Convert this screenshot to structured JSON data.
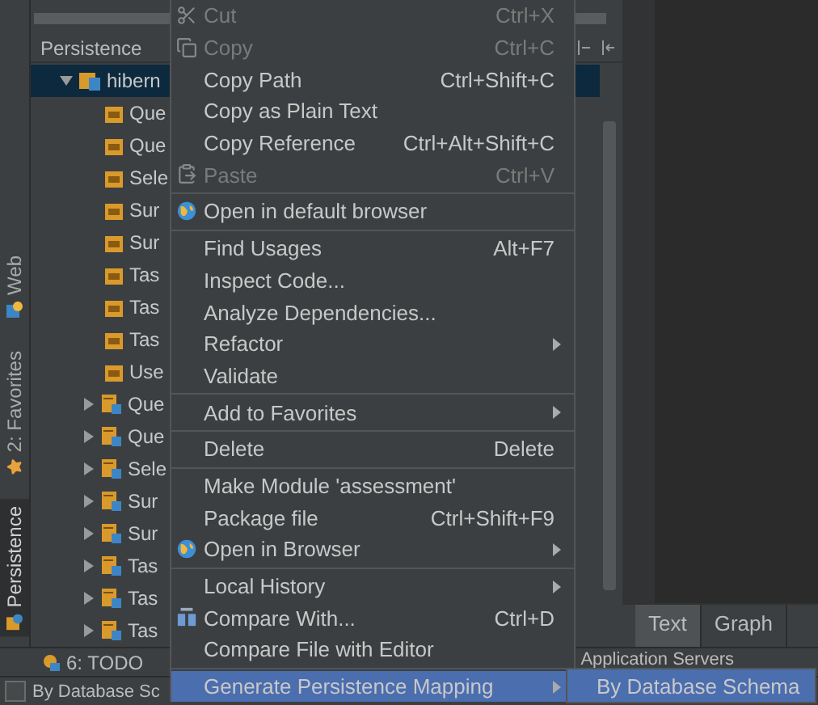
{
  "tool_strip": [
    {
      "label": "Web",
      "selected": false
    },
    {
      "label": "2: Favorites",
      "selected": false
    },
    {
      "label": "Persistence",
      "selected": true
    }
  ],
  "panel": {
    "title": "Persistence"
  },
  "tree": [
    {
      "label": "hibern",
      "selected": true,
      "expanded": true,
      "children": [
        {
          "label": "Que",
          "kind": "file"
        },
        {
          "label": "Que",
          "kind": "file"
        },
        {
          "label": "Sele",
          "kind": "file"
        },
        {
          "label": "Sur",
          "kind": "file"
        },
        {
          "label": "Sur",
          "kind": "file"
        },
        {
          "label": "Tas",
          "kind": "file"
        },
        {
          "label": "Tas",
          "kind": "file"
        },
        {
          "label": "Tas",
          "kind": "file"
        },
        {
          "label": "Use",
          "kind": "file"
        },
        {
          "label": "Que",
          "kind": "entity",
          "expanded": false
        },
        {
          "label": "Que",
          "kind": "entity",
          "expanded": false
        },
        {
          "label": "Sele",
          "kind": "entity",
          "expanded": false
        },
        {
          "label": "Sur",
          "kind": "entity",
          "expanded": false
        },
        {
          "label": "Sur",
          "kind": "entity",
          "expanded": false
        },
        {
          "label": "Tas",
          "kind": "entity",
          "expanded": false
        },
        {
          "label": "Tas",
          "kind": "entity",
          "expanded": false
        },
        {
          "label": "Tas",
          "kind": "entity",
          "expanded": false
        }
      ]
    }
  ],
  "context_menu": [
    {
      "kind": "item",
      "label": "Cut",
      "shortcut": "Ctrl+X",
      "disabled": true,
      "selected": false
    },
    {
      "kind": "item",
      "label": "Copy",
      "shortcut": "Ctrl+C",
      "disabled": true,
      "selected": false
    },
    {
      "kind": "item",
      "label": "Copy Path",
      "shortcut": "Ctrl+Shift+C",
      "disabled": false,
      "selected": false
    },
    {
      "kind": "item",
      "label": "Copy as Plain Text",
      "disabled": false,
      "selected": false
    },
    {
      "kind": "item",
      "label": "Copy Reference",
      "shortcut": "Ctrl+Alt+Shift+C",
      "disabled": false,
      "selected": false
    },
    {
      "kind": "item",
      "label": "Paste",
      "shortcut": "Ctrl+V",
      "disabled": true,
      "selected": false
    },
    {
      "kind": "separator"
    },
    {
      "kind": "item",
      "label": "Open in default browser",
      "disabled": false,
      "selected": false
    },
    {
      "kind": "separator"
    },
    {
      "kind": "item",
      "label": "Find Usages",
      "shortcut": "Alt+F7",
      "disabled": false,
      "selected": false
    },
    {
      "kind": "item",
      "label": "Inspect Code...",
      "disabled": false,
      "selected": false
    },
    {
      "kind": "item",
      "label": "Analyze Dependencies...",
      "disabled": false,
      "selected": false
    },
    {
      "kind": "item",
      "label": "Refactor",
      "submenu": true,
      "disabled": false,
      "selected": false
    },
    {
      "kind": "item",
      "label": "Validate",
      "disabled": false,
      "selected": false
    },
    {
      "kind": "separator"
    },
    {
      "kind": "item",
      "label": "Add to Favorites",
      "submenu": true,
      "disabled": false,
      "selected": false
    },
    {
      "kind": "separator"
    },
    {
      "kind": "item",
      "label": "Delete",
      "shortcut": "Delete",
      "disabled": false,
      "selected": false
    },
    {
      "kind": "separator"
    },
    {
      "kind": "item",
      "label": "Make Module 'assessment'",
      "disabled": false,
      "selected": false
    },
    {
      "kind": "item",
      "label": "Package file",
      "shortcut": "Ctrl+Shift+F9",
      "disabled": false,
      "selected": false
    },
    {
      "kind": "item",
      "label": "Open in Browser",
      "submenu": true,
      "disabled": false,
      "selected": false
    },
    {
      "kind": "separator"
    },
    {
      "kind": "item",
      "label": "Local History",
      "submenu": true,
      "disabled": false,
      "selected": false
    },
    {
      "kind": "item",
      "label": "Compare With...",
      "shortcut": "Ctrl+D",
      "disabled": false,
      "selected": false
    },
    {
      "kind": "item",
      "label": "Compare File with Editor",
      "disabled": false,
      "selected": false
    },
    {
      "kind": "separator"
    },
    {
      "kind": "item",
      "label": "Generate Persistence Mapping",
      "submenu": true,
      "disabled": false,
      "selected": true
    }
  ],
  "submenu": [
    {
      "label": "By Database Schema",
      "selected": true
    }
  ],
  "editor_tabs": [
    {
      "label": "Text",
      "selected": true
    },
    {
      "label": "Graph",
      "selected": false
    }
  ],
  "bottom_bar": {
    "todo": "6: TODO",
    "servers": "Application Servers"
  },
  "status": {
    "label": "By Database Sc",
    "checked": false
  }
}
